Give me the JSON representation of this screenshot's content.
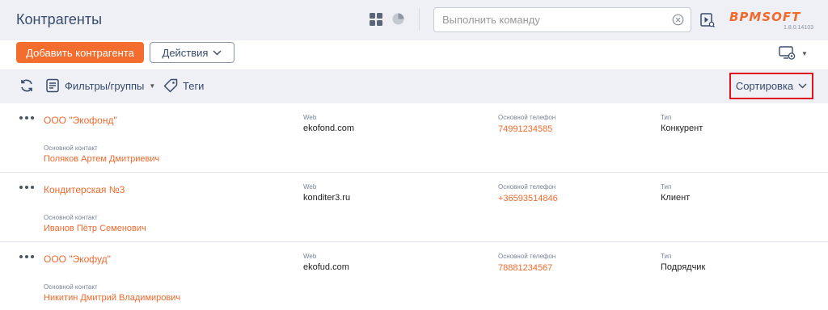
{
  "header": {
    "title": "Контрагенты",
    "command_placeholder": "Выполнить команду",
    "logo_text": "BPMSOFT",
    "version": "1.8.0.14103",
    "accent_color": "#f26d2e"
  },
  "toolbar": {
    "add_label": "Добавить контрагента",
    "actions_label": "Действия"
  },
  "filters": {
    "filters_label": "Фильтры/группы",
    "tags_label": "Теги",
    "sort_label": "Сортировка"
  },
  "labels": {
    "contact": "Основной контакт",
    "web": "Web",
    "phone": "Основной телефон",
    "type": "Тип"
  },
  "rows": [
    {
      "name": "ООО \"Экофонд\"",
      "contact": "Поляков Артем Дмитриевич",
      "web": "ekofond.com",
      "phone": "74991234585",
      "type": "Конкурент"
    },
    {
      "name": "Кондитерская №3",
      "contact": "Иванов Пётр Семенович",
      "web": "konditer3.ru",
      "phone": "+36593514846",
      "type": "Клиент"
    },
    {
      "name": "ООО \"Экофуд\"",
      "contact": "Никитин Дмитрий Владимирович",
      "web": "ekofud.com",
      "phone": "78881234567",
      "type": "Подрядчик"
    }
  ],
  "icons": {
    "view_tiles": "grid-icon",
    "view_dashboards": "pie-chart-icon",
    "clear": "clear-circle-icon",
    "run": "play-search-icon",
    "refresh": "refresh-icon",
    "filters": "filter-list-icon",
    "tags": "tag-icon",
    "settings": "monitor-gear-icon",
    "row_menu": "more-dots-icon"
  }
}
